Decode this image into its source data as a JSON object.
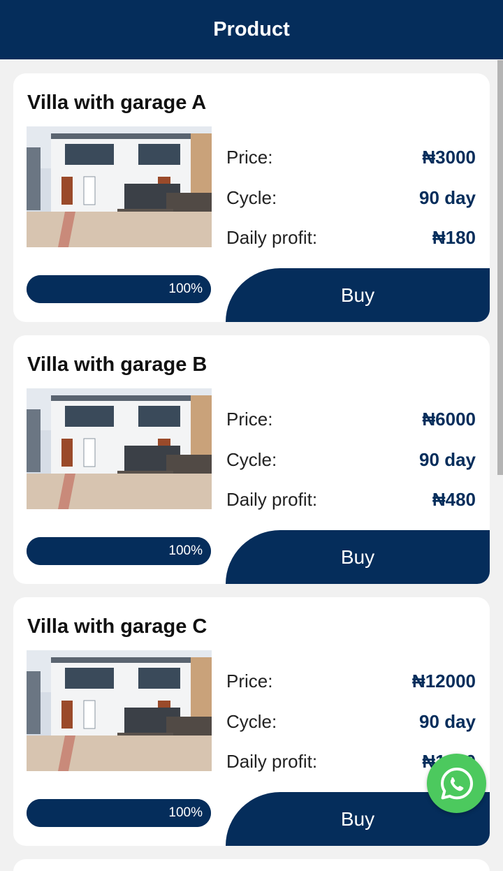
{
  "header": {
    "title": "Product"
  },
  "products": [
    {
      "title": "Villa with garage A",
      "price_label": "Price:",
      "price": "₦3000",
      "cycle_label": "Cycle:",
      "cycle": "90 day",
      "profit_label": "Daily profit:",
      "profit": "₦180",
      "progress_text": "100%",
      "progress_value": 1.0,
      "buy_label": "Buy"
    },
    {
      "title": "Villa with garage B",
      "price_label": "Price:",
      "price": "₦6000",
      "cycle_label": "Cycle:",
      "cycle": "90 day",
      "profit_label": "Daily profit:",
      "profit": "₦480",
      "progress_text": "100%",
      "progress_value": 1.0,
      "buy_label": "Buy"
    },
    {
      "title": "Villa with garage C",
      "price_label": "Price:",
      "price": "₦12000",
      "cycle_label": "Cycle:",
      "cycle": "90 day",
      "profit_label": "Daily profit:",
      "profit": "₦1200",
      "progress_text": "100%",
      "progress_value": 1.0,
      "buy_label": "Buy"
    }
  ],
  "icons": {
    "product_photo": "villa-photo",
    "chat": "whatsapp-icon"
  },
  "colors": {
    "primary": "#052d5b",
    "background": "#f1f1f1",
    "whatsapp": "#4cc95e"
  }
}
